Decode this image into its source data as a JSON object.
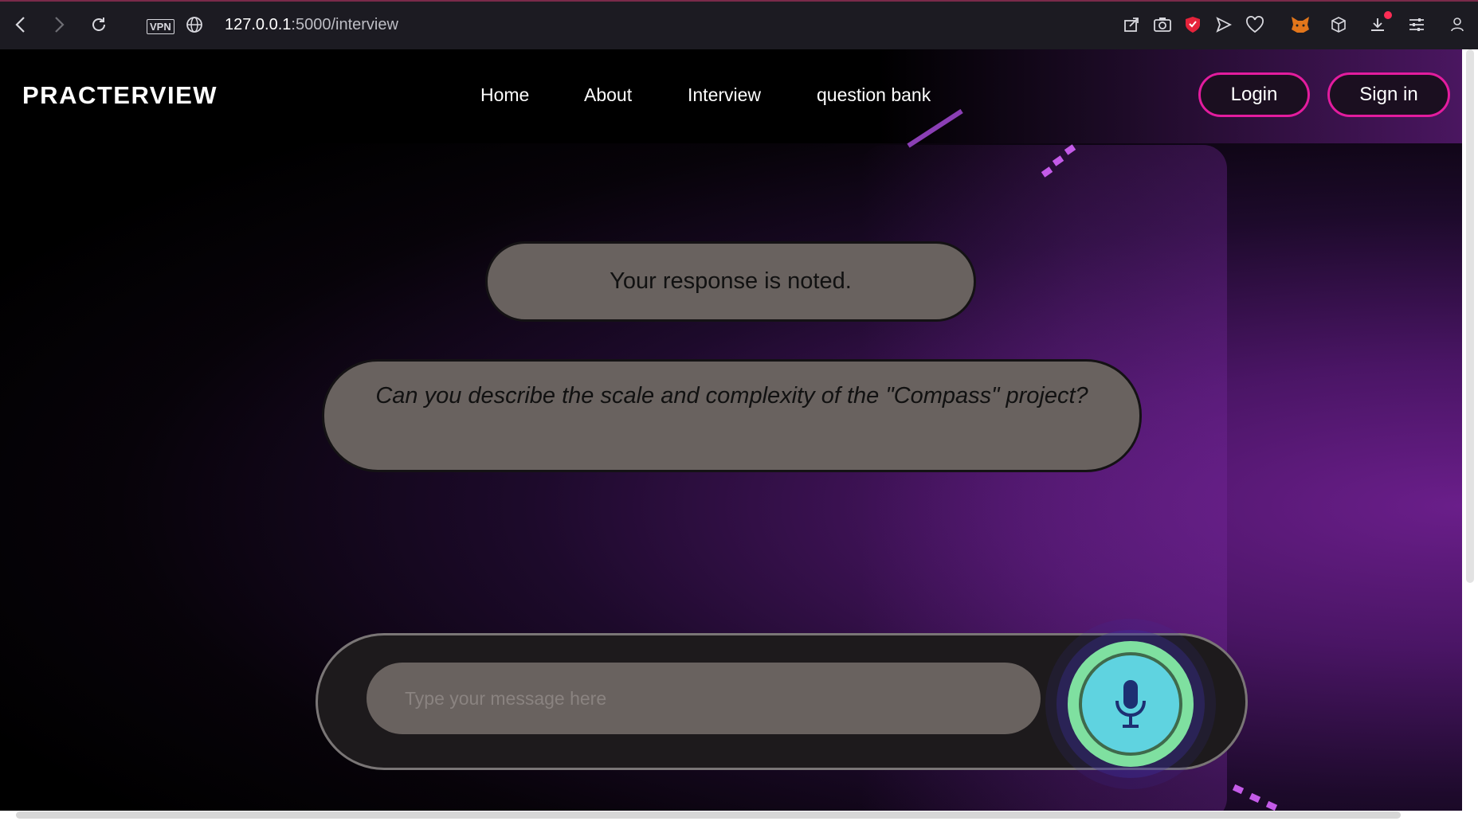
{
  "browser": {
    "url_host": "127.0.0.1",
    "url_path": ":5000/interview",
    "vpn_label": "VPN",
    "icons": [
      "back-icon",
      "forward-icon",
      "reload-icon",
      "globe-icon",
      "share-icon",
      "camera-icon",
      "shield-icon",
      "send-icon",
      "heart-icon",
      "metamask-fox-icon",
      "cube-icon",
      "download-icon",
      "menu-settings-icon",
      "profile-icon"
    ]
  },
  "nav": {
    "logo": "PRACTERVIEW",
    "links": [
      "Home",
      "About",
      "Interview",
      "question bank"
    ],
    "login_label": "Login",
    "signin_label": "Sign in"
  },
  "chat": {
    "status_message": "Your response is noted.",
    "question": "Can you describe the scale and complexity of the \"Compass\" project?"
  },
  "composer": {
    "placeholder": "Type your message here",
    "value": "",
    "mic_icon": "microphone-icon"
  },
  "colors": {
    "accent_pink": "#e31c9e",
    "bubble_gray": "#69625f",
    "mic_green": "#7fe0a0",
    "mic_cyan": "#5fd3e0",
    "purple": "#6a1e8a"
  }
}
